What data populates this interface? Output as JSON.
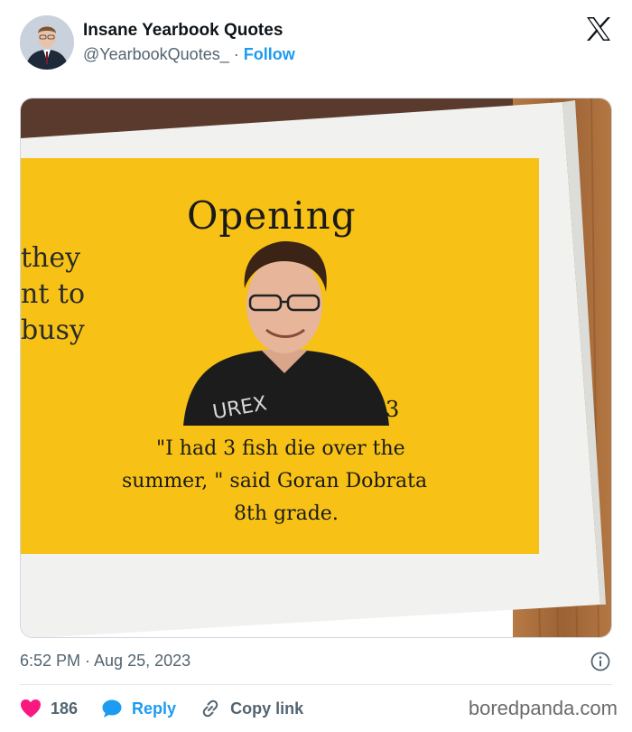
{
  "tweet": {
    "author": {
      "display_name": "Insane Yearbook Quotes",
      "handle": "@YearbookQuotes_",
      "separator": "·",
      "follow_label": "Follow",
      "avatar_icon": "profile-photo"
    },
    "brand_icon": "x-logo-icon",
    "media": {
      "page_heading": "Opening",
      "left_column_fragments": [
        "they",
        "nt to",
        "busy"
      ],
      "page_number_fragment": "3",
      "shirt_text": "UREX",
      "quote_lines": [
        "\"I had 3 fish die over the",
        "summer, \" said  Goran Dobrata",
        "8th grade."
      ],
      "colors": {
        "page_yellow": "#f7c215",
        "table_wood": "#a86a3a",
        "paper": "#f4f4f2"
      }
    },
    "timestamp": "6:52 PM · Aug 25, 2023",
    "actions": {
      "like_count": "186",
      "reply_label": "Reply",
      "copy_link_label": "Copy link"
    },
    "watermark": "boredpanda.com",
    "colors": {
      "accent_blue": "#1d9bf0",
      "like_red": "#f91880",
      "muted_text": "#536471"
    }
  }
}
